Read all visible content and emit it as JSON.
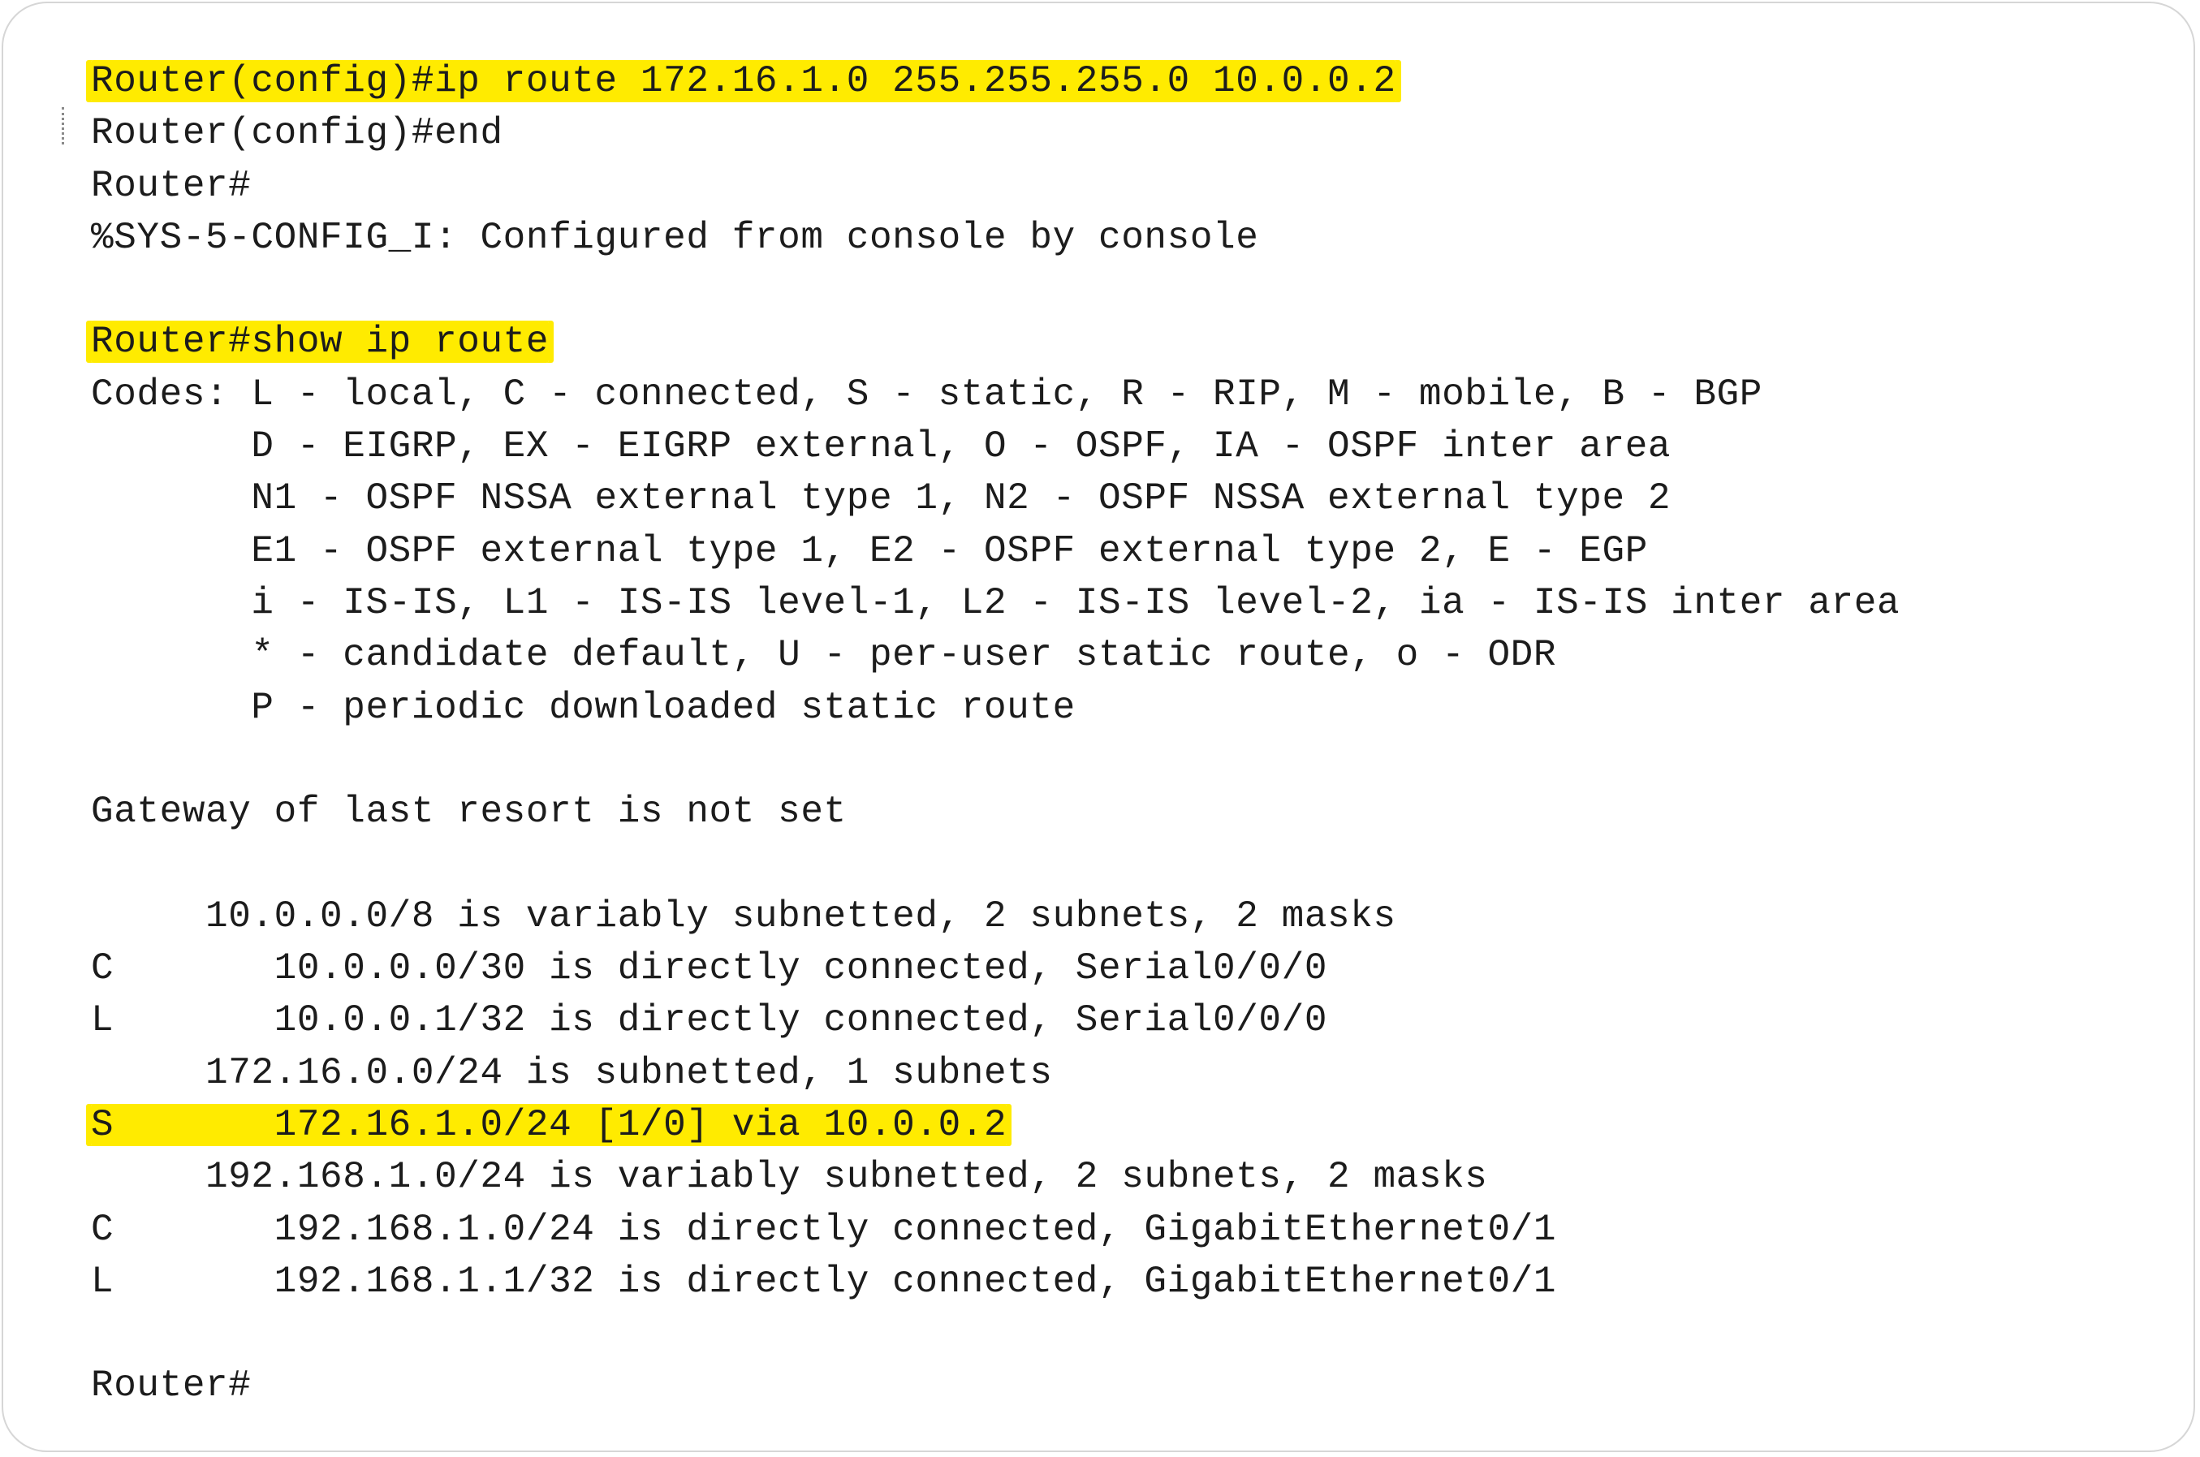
{
  "terminal": {
    "lines": [
      {
        "text": "Router(config)#ip route 172.16.1.0 255.255.255.0 10.0.0.2",
        "highlight": true
      },
      {
        "text": "Router(config)#end",
        "highlight": false
      },
      {
        "text": "Router#",
        "highlight": false
      },
      {
        "text": "%SYS-5-CONFIG_I: Configured from console by console",
        "highlight": false
      },
      {
        "text": "",
        "highlight": false
      },
      {
        "text": "Router#show ip route",
        "highlight": true
      },
      {
        "text": "Codes: L - local, C - connected, S - static, R - RIP, M - mobile, B - BGP",
        "highlight": false
      },
      {
        "text": "       D - EIGRP, EX - EIGRP external, O - OSPF, IA - OSPF inter area",
        "highlight": false
      },
      {
        "text": "       N1 - OSPF NSSA external type 1, N2 - OSPF NSSA external type 2",
        "highlight": false
      },
      {
        "text": "       E1 - OSPF external type 1, E2 - OSPF external type 2, E - EGP",
        "highlight": false
      },
      {
        "text": "       i - IS-IS, L1 - IS-IS level-1, L2 - IS-IS level-2, ia - IS-IS inter area",
        "highlight": false
      },
      {
        "text": "       * - candidate default, U - per-user static route, o - ODR",
        "highlight": false
      },
      {
        "text": "       P - periodic downloaded static route",
        "highlight": false
      },
      {
        "text": "",
        "highlight": false
      },
      {
        "text": "Gateway of last resort is not set",
        "highlight": false
      },
      {
        "text": "",
        "highlight": false
      },
      {
        "text": "     10.0.0.0/8 is variably subnetted, 2 subnets, 2 masks",
        "highlight": false
      },
      {
        "text": "C       10.0.0.0/30 is directly connected, Serial0/0/0",
        "highlight": false
      },
      {
        "text": "L       10.0.0.1/32 is directly connected, Serial0/0/0",
        "highlight": false
      },
      {
        "text": "     172.16.0.0/24 is subnetted, 1 subnets",
        "highlight": false
      },
      {
        "text": "S       172.16.1.0/24 [1/0] via 10.0.0.2",
        "highlight": true
      },
      {
        "text": "     192.168.1.0/24 is variably subnetted, 2 subnets, 2 masks",
        "highlight": false
      },
      {
        "text": "C       192.168.1.0/24 is directly connected, GigabitEthernet0/1",
        "highlight": false
      },
      {
        "text": "L       192.168.1.1/32 is directly connected, GigabitEthernet0/1",
        "highlight": false
      },
      {
        "text": "",
        "highlight": false
      },
      {
        "text": "Router#",
        "highlight": false
      }
    ]
  },
  "colors": {
    "highlight": "#ffeb00",
    "text": "#1c1c1c",
    "background": "#ffffff"
  }
}
